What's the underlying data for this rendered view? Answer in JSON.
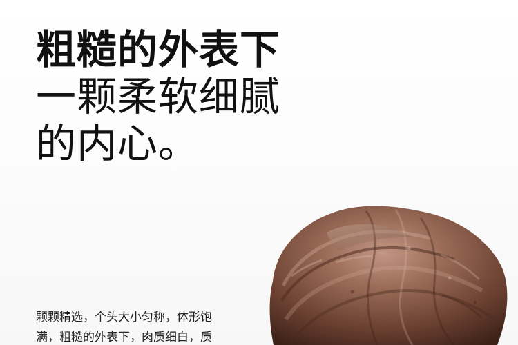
{
  "headline": {
    "line1": "粗糙的外表下",
    "line2": "一颗柔软细腻",
    "line3": "的内心。"
  },
  "body": {
    "line1": "颗颗精选，个头大小匀称，体形饱",
    "line2": "满，粗糙的外表下，肉质细白，质"
  },
  "image": {
    "icon": "taro-root-photo",
    "colors": {
      "skin_dark": "#5a3426",
      "skin_mid": "#8a5a47",
      "skin_light": "#c59a86"
    }
  }
}
